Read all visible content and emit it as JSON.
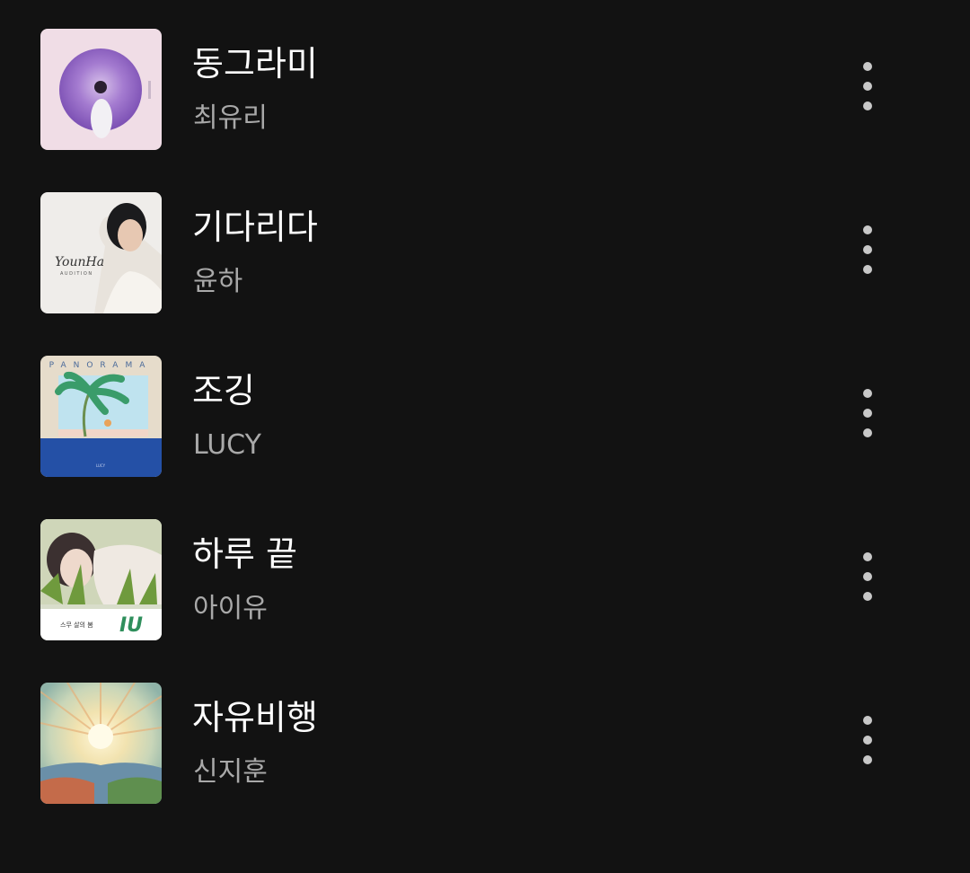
{
  "playlist": {
    "tracks": [
      {
        "title": "동그라미",
        "artist": "최유리",
        "art_icon": "album-art-purple-circle"
      },
      {
        "title": "기다리다",
        "artist": "윤하",
        "art_icon": "album-art-portrait-younha",
        "art_text": {
          "logo": "YounHa",
          "caption": "AUDITION"
        }
      },
      {
        "title": "조깅",
        "artist": "LUCY",
        "art_icon": "album-art-panorama",
        "art_text": {
          "header": "PANORAMA",
          "footer": "LUCY"
        }
      },
      {
        "title": "하루 끝",
        "artist": "아이유",
        "art_icon": "album-art-portrait-iu",
        "art_text": {
          "caption": "스무 살의 봄",
          "logo": "IU"
        }
      },
      {
        "title": "자유비행",
        "artist": "신지훈",
        "art_icon": "album-art-sunburst-painting"
      }
    ],
    "more_icon": "more-vertical-icon"
  },
  "colors": {
    "background": "#121212",
    "title": "#ffffff",
    "artist": "#a9a9a9",
    "icon": "#c8c8c8"
  }
}
